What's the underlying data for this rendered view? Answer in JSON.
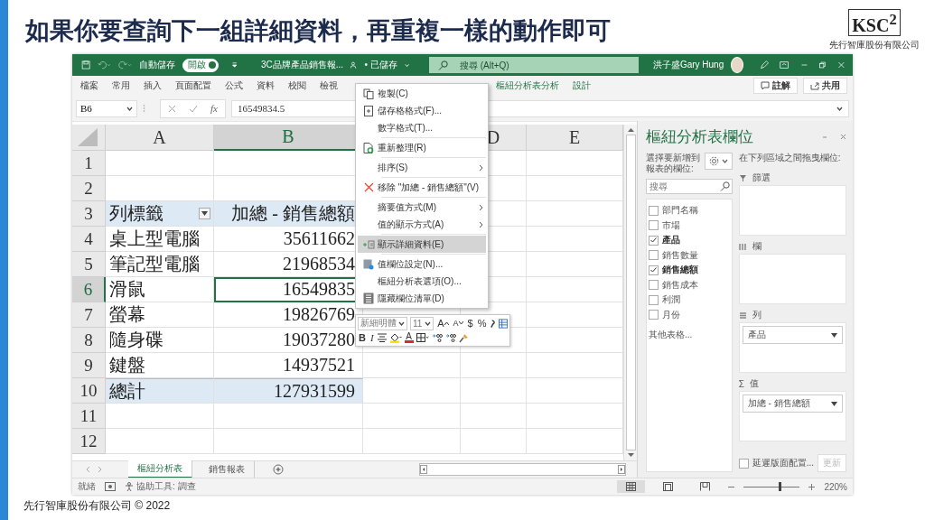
{
  "slide": {
    "title": "如果你要查詢下一組詳細資料，再重複一樣的動作即可",
    "logo": "KSC$^{2}$",
    "company": "先行智庫股份有限公司",
    "footer": "先行智庫股份有限公司 © 2022"
  },
  "title_bar": {
    "autosave_label": "自動儲存",
    "autosave": {
      "label": "開啟",
      "on": true
    },
    "file_name": "3C品牌產品銷售報...",
    "save_status": "• 已儲存",
    "search": {
      "placeholder": "搜尋 (Alt+Q)"
    },
    "user": "洪子盛Gary Hung"
  },
  "ribbon": {
    "tabs": [
      {
        "label": "檔案",
        "kind": "normal"
      },
      {
        "label": "常用",
        "kind": "normal"
      },
      {
        "label": "插入",
        "kind": "normal"
      },
      {
        "label": "頁面配置",
        "kind": "normal"
      },
      {
        "label": "公式",
        "kind": "normal"
      },
      {
        "label": "資料",
        "kind": "normal"
      },
      {
        "label": "校閱",
        "kind": "normal"
      },
      {
        "label": "檢視",
        "kind": "normal"
      },
      {
        "label": "樞紐分析表分析",
        "kind": "contextual"
      },
      {
        "label": "設計",
        "kind": "contextual"
      }
    ],
    "buttons": [
      {
        "label": "註解",
        "kind": "comment"
      },
      {
        "label": "共用",
        "kind": "share"
      }
    ]
  },
  "formula_bar": {
    "name_box": "B6",
    "function_label": "fx",
    "value": "16549834.5"
  },
  "sheet": {
    "columns": [
      {
        "label": "A",
        "selected": false
      },
      {
        "label": "B",
        "selected": true
      },
      {
        "label": "D",
        "selected": false
      },
      {
        "label": "E",
        "selected": false
      }
    ],
    "rows": [
      {
        "header": "1",
        "kind": "blank",
        "selected": false
      },
      {
        "header": "2",
        "kind": "blank",
        "selected": false
      },
      {
        "header": "3",
        "kind": "header",
        "label": "列標籤",
        "value": "加總 - 銷售總額",
        "selected": false
      },
      {
        "header": "4",
        "kind": "data",
        "label": "桌上型電腦",
        "value": "35611662",
        "selected": false
      },
      {
        "header": "5",
        "kind": "data",
        "label": "筆記型電腦",
        "value": "21968534",
        "selected": false
      },
      {
        "header": "6",
        "kind": "data",
        "label": "滑鼠",
        "value": "16549835",
        "selected": true
      },
      {
        "header": "7",
        "kind": "data",
        "label": "螢幕",
        "value": "19826769",
        "selected": false
      },
      {
        "header": "8",
        "kind": "data",
        "label": "隨身碟",
        "value": "19037280",
        "selected": false
      },
      {
        "header": "9",
        "kind": "data",
        "label": "鍵盤",
        "value": "14937521",
        "selected": false
      },
      {
        "header": "10",
        "kind": "total",
        "label": "總計",
        "value": "127931599",
        "selected": false
      },
      {
        "header": "11",
        "kind": "blank",
        "selected": false
      },
      {
        "header": "12",
        "kind": "blank",
        "selected": false
      }
    ]
  },
  "context_menu": {
    "items": [
      {
        "kind": "copy",
        "label": "複製(C)",
        "selected": false
      },
      {
        "kind": "format",
        "label": "儲存格格式(F)...",
        "selected": false
      },
      {
        "kind": "plain",
        "label": "數字格式(T)...",
        "selected": false
      },
      {
        "kind": "separator"
      },
      {
        "kind": "refresh",
        "label": "重新整理(R)",
        "selected": false
      },
      {
        "kind": "separator"
      },
      {
        "kind": "submenu",
        "label": "排序(S)",
        "selected": false
      },
      {
        "kind": "separator"
      },
      {
        "kind": "remove",
        "label": "移除 \"加總 - 銷售總額\"(V)",
        "selected": false
      },
      {
        "kind": "separator"
      },
      {
        "kind": "submenu",
        "label": "摘要值方式(M)",
        "selected": false
      },
      {
        "kind": "submenu",
        "label": "值的顯示方式(A)",
        "selected": false
      },
      {
        "kind": "separator"
      },
      {
        "kind": "detail",
        "label": "顯示詳細資料(E)",
        "selected": true
      },
      {
        "kind": "separator"
      },
      {
        "kind": "settings",
        "label": "值欄位設定(N)...",
        "selected": false
      },
      {
        "kind": "plain",
        "label": "樞紐分析表選項(O)...",
        "selected": false
      },
      {
        "kind": "hide",
        "label": "隱藏欄位清單(D)",
        "selected": false
      }
    ]
  },
  "mini_toolbar": {
    "font": "新細明體",
    "size": "11",
    "row_1": [
      {
        "kind": "grow",
        "label": "A"
      },
      {
        "kind": "shrink",
        "label": "A"
      },
      {
        "kind": "text",
        "label": "$"
      },
      {
        "kind": "text",
        "label": "%"
      },
      {
        "kind": "comma"
      },
      {
        "kind": "table"
      }
    ],
    "row_2": [
      {
        "kind": "bold",
        "label": "B"
      },
      {
        "kind": "italic",
        "label": "I"
      },
      {
        "kind": "align"
      },
      {
        "kind": "fill"
      },
      {
        "kind": "fontcolor",
        "label": "A"
      },
      {
        "kind": "border"
      },
      {
        "kind": "decimal"
      },
      {
        "kind": "decimal"
      },
      {
        "kind": "brush"
      }
    ]
  },
  "pivot_pane": {
    "title": "樞紐分析表欄位",
    "choose_label": "選擇要新增到報表的欄位:",
    "drag_label": "在下列區域之間拖曳欄位:",
    "search": {
      "placeholder": "搜尋"
    },
    "fields": [
      {
        "label": "部門名稱",
        "checked": false
      },
      {
        "label": "市場",
        "checked": false
      },
      {
        "label": "產品",
        "checked": true
      },
      {
        "label": "銷售數量",
        "checked": false
      },
      {
        "label": "銷售總額",
        "checked": true
      },
      {
        "label": "銷售成本",
        "checked": false
      },
      {
        "label": "利潤",
        "checked": false
      },
      {
        "label": "月份",
        "checked": false
      }
    ],
    "more_tables": "其他表格...",
    "areas": [
      {
        "kind": "filter",
        "label": "篩選"
      },
      {
        "kind": "columns",
        "label": "欄"
      },
      {
        "kind": "rows",
        "label": "列",
        "items": [
          "產品"
        ]
      },
      {
        "kind": "values",
        "label": "值",
        "symbol": "Σ",
        "items": [
          "加總 - 銷售總額"
        ]
      }
    ],
    "defer": {
      "label": "延遲版面配置...",
      "checked": false
    },
    "update_button": {
      "label": "更新",
      "disabled": true
    }
  },
  "sheet_tabs": [
    {
      "label": "樞紐分析表",
      "selected": true
    },
    {
      "label": "銷售報表",
      "selected": false
    }
  ],
  "status_bar": {
    "ready": "就緒",
    "accessibility": "協助工具: 調查",
    "views": [
      {
        "kind": "normal",
        "selected": true
      },
      {
        "kind": "page_layout",
        "selected": false
      },
      {
        "kind": "page_break",
        "selected": false
      }
    ],
    "zoom": {
      "level": 0.65,
      "reading": "220%"
    }
  }
}
